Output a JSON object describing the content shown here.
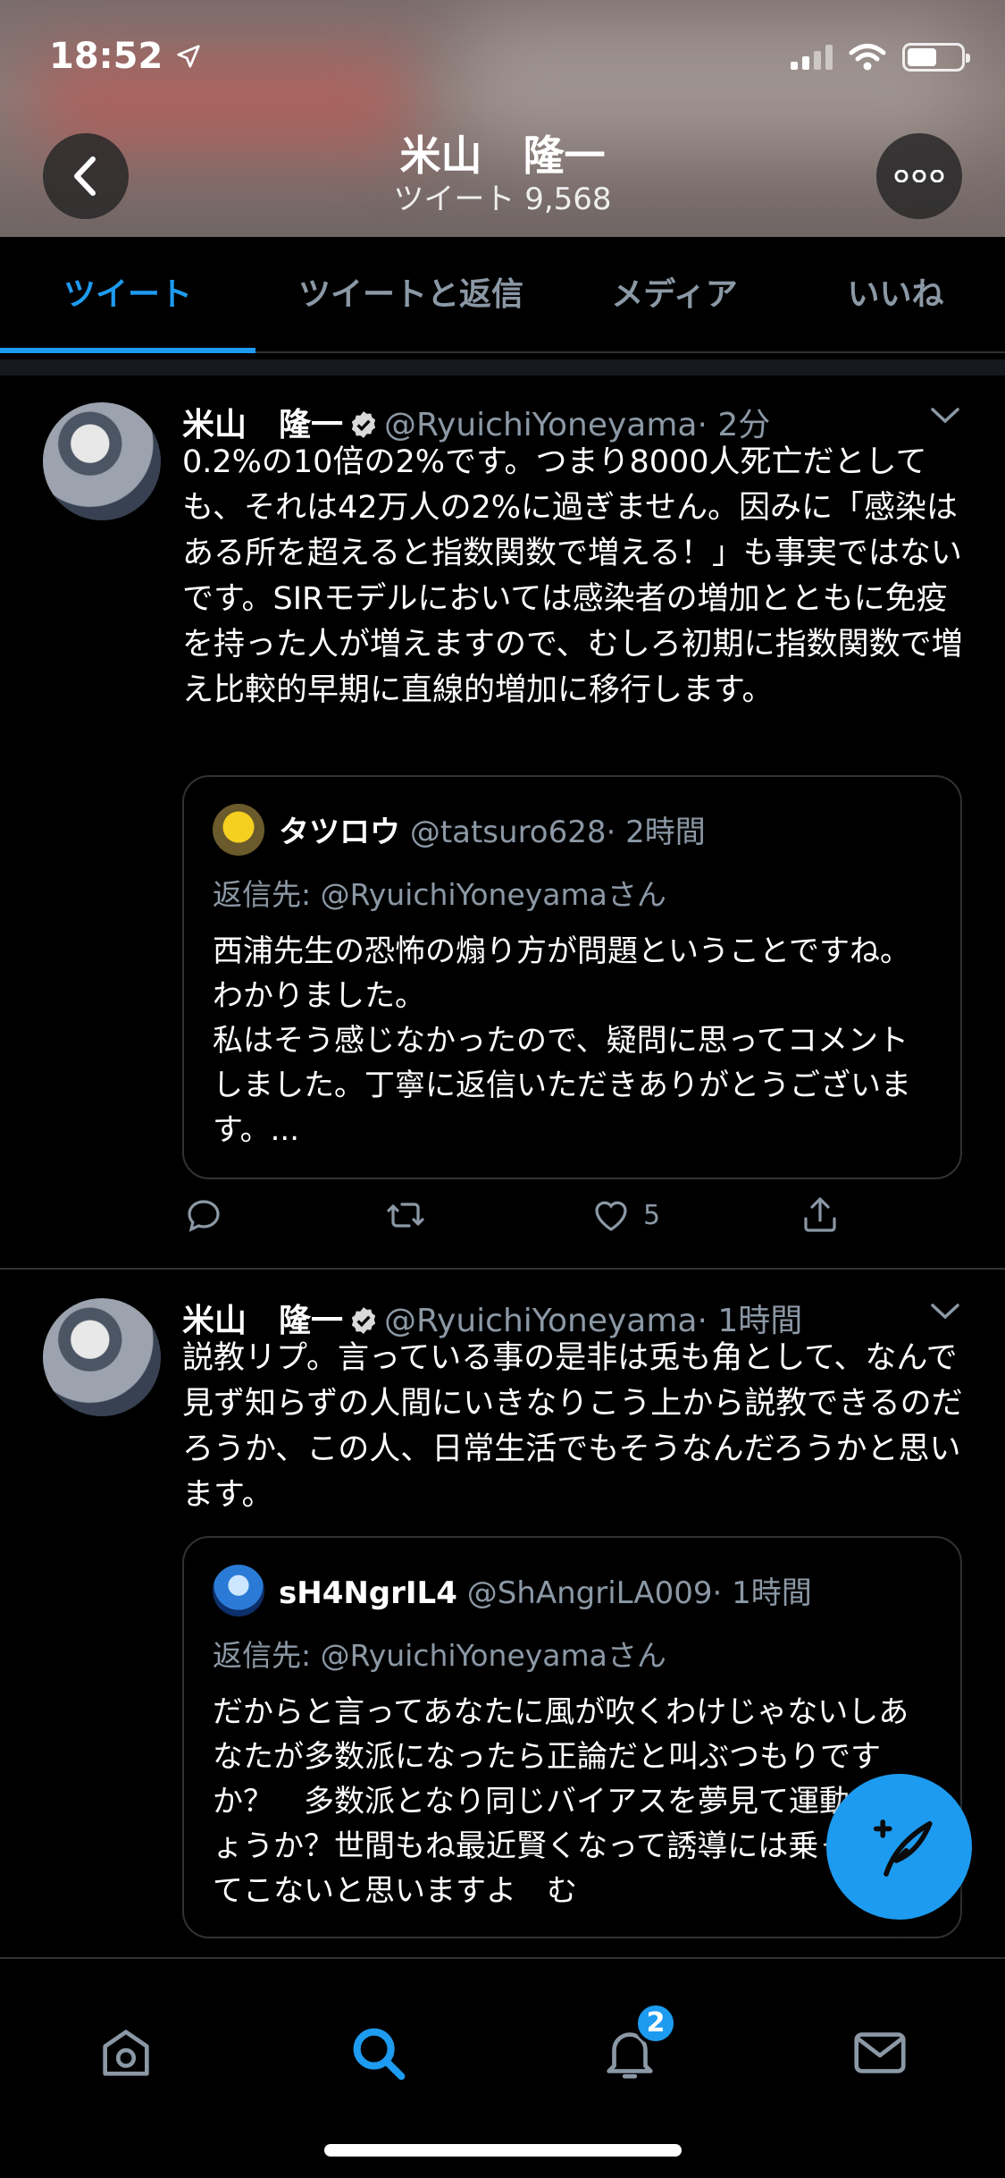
{
  "status_bar": {
    "time": "18:52",
    "icons": [
      "location-icon",
      "signal-icon",
      "wifi-icon",
      "battery-icon"
    ]
  },
  "header": {
    "profile_name": "米山　隆一",
    "tweet_count": "ツイート 9,568"
  },
  "tabs": [
    {
      "label": "ツイート",
      "active": true
    },
    {
      "label": "ツイートと返信"
    },
    {
      "label": "メディア"
    },
    {
      "label": "いいね"
    }
  ],
  "tweets": [
    {
      "name": "米山　隆一",
      "handle": "@RyuichiYoneyama",
      "time": "· 2分",
      "text": "0.2%の10倍の2%です。つまり8000人死亡だとしても、それは42万人の2%に過ぎません。因みに「感染はある所を超えると指数関数で増える！」も事実ではないです。SIRモデルにおいては感染者の増加とともに免疫を持った人が増えますので、むしろ初期に指数関数で増え比較的早期に直線的増加に移行します。",
      "quote": {
        "name": "タツロウ",
        "handle": "@tatsuro628",
        "time": "· 2時間",
        "reply_to": "返信先: @RyuichiYoneyamaさん",
        "text": "西浦先生の恐怖の煽り方が問題ということですね。わかりました。\n私はそう感じなかったので、疑問に思ってコメントしました。丁寧に返信いただきありがとうございます。..."
      },
      "likes": "5"
    },
    {
      "name": "米山　隆一",
      "handle": "@RyuichiYoneyama",
      "time": "· 1時間",
      "text": "説教リプ。言っている事の是非は兎も角として、なんで見ず知らずの人間にいきなりこう上から説教できるのだろうか、この人、日常生活でもそうなんだろうかと思います。",
      "quote": {
        "name": "sH4NgrIL4",
        "handle": "@ShAngriLA009",
        "time": "· 1時間",
        "reply_to": "返信先: @RyuichiYoneyamaさん",
        "text": "だからと言ってあなたに風が吹くわけじゃないしあなたが多数派になったら正論だと叫ぶつもりですか？　多数派となり同じバイアスを夢見て運動でしょうか？世間もね最近賢くなって誘導には乗っかってこないと思いますよ　む"
      }
    }
  ],
  "bottom_nav": {
    "items": [
      "home-icon",
      "search-icon",
      "notifications-icon",
      "messages-icon"
    ],
    "notification_badge": "2",
    "active": "search-icon"
  },
  "colors": {
    "accent": "#1d9bf0",
    "muted": "#8b98a5",
    "divider": "#2f3336",
    "background": "#000000"
  }
}
